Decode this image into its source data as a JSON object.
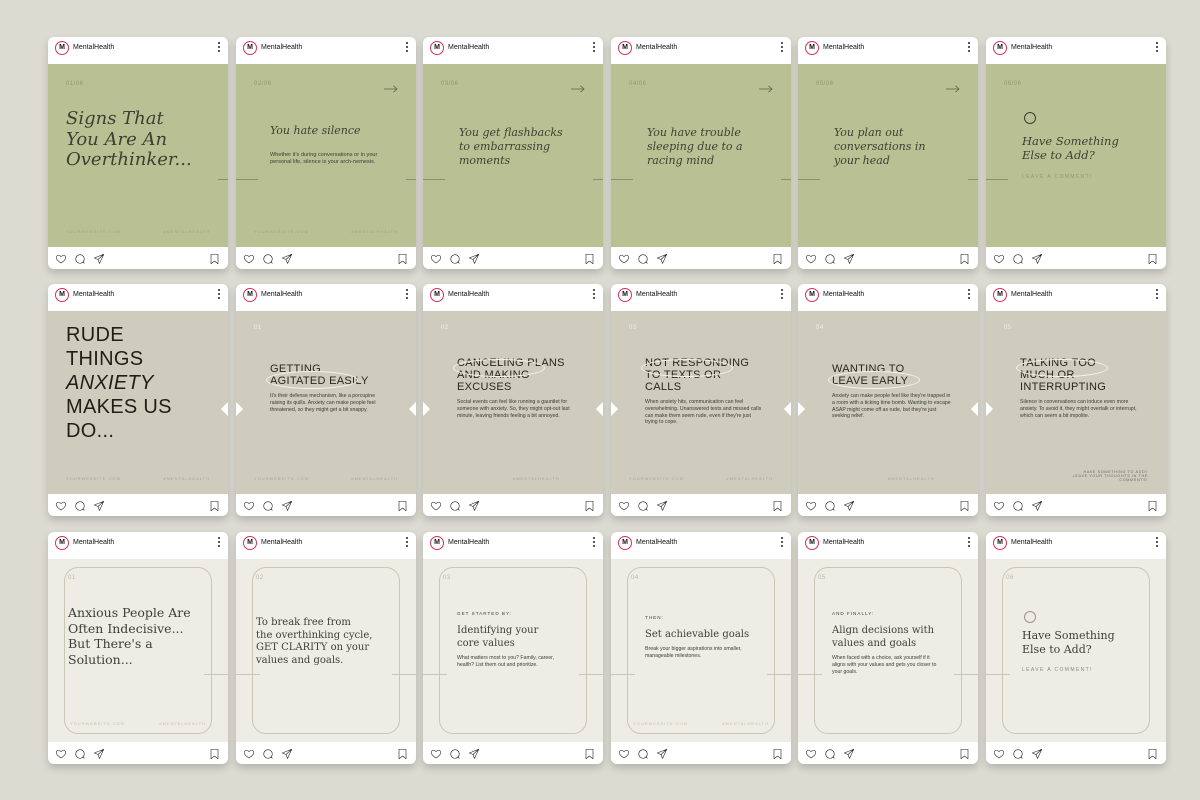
{
  "profile": {
    "username": "MentalHealth",
    "avatar_letter": "M"
  },
  "colors": {
    "green": "#b9c194",
    "beige": "#cfccbd",
    "light": "#eeede5",
    "background": "#dcdbd2"
  },
  "footer": {
    "website": "YOURWEBSITE.COM",
    "hashtag": "#MENTALHEALTH"
  },
  "row1": [
    {
      "num": "01/06",
      "title": "Signs That You Are An Overthinker...",
      "title_lines": [
        "Signs That",
        "You Are An",
        "Overthinker..."
      ]
    },
    {
      "num": "02/06",
      "title": "You hate silence",
      "body": "Whether it's during conversations or in your personal life, silence is your arch-nemesis."
    },
    {
      "num": "03/06",
      "title_lines": [
        "You get flashbacks",
        "to embarrassing",
        "moments"
      ]
    },
    {
      "num": "04/06",
      "title_lines": [
        "You have trouble",
        "sleeping due to a",
        "racing mind"
      ]
    },
    {
      "num": "05/06",
      "title_lines": [
        "You plan out",
        "conversations in",
        "your head"
      ]
    },
    {
      "num": "06/06",
      "title_lines": [
        "Have Something",
        "Else to Add?"
      ],
      "cta": "LEAVE A COMMENT!"
    }
  ],
  "row2": [
    {
      "title_lines": [
        "RUDE",
        "THINGS",
        "ANXIETY",
        "MAKES US",
        "DO..."
      ]
    },
    {
      "num": "01",
      "title_lines": [
        "GETTING",
        "AGITATED EASILY"
      ],
      "body": "It's their defense mechanism, like a porcupine raising its quills. Anxiety can make people feel threatened, so they might get a bit snappy."
    },
    {
      "num": "02",
      "title_lines": [
        "CANCELING PLANS",
        "AND MAKING",
        "EXCUSES"
      ],
      "body": "Social events can feel like running a gauntlet for someone with anxiety. So, they might opt-out last minute, leaving friends feeling a bit annoyed."
    },
    {
      "num": "03",
      "title_lines": [
        "NOT RESPONDING",
        "TO TEXTS OR",
        "CALLS"
      ],
      "body": "When anxiety hits, communication can feel overwhelming. Unanswered texts and missed calls can make them seem rude, even if they're just trying to cope."
    },
    {
      "num": "04",
      "title_lines": [
        "WANTING TO",
        "LEAVE EARLY"
      ],
      "body": "Anxiety can make people feel like they're trapped in a room with a ticking time bomb. Wanting to escape ASAP might come off as rude, but they're just seeking relief."
    },
    {
      "num": "05",
      "title_lines": [
        "TALKING TOO",
        "MUCH OR",
        "INTERRUPTING"
      ],
      "body": "Silence in conversations can induce even more anxiety. To avoid it, they might overtalk or interrupt, which can seem a bit impolite.",
      "cta": "HAVE SOMETHING TO ADD? LEAVE YOUR THOUGHTS IN THE COMMENTS!"
    }
  ],
  "row3": [
    {
      "num": "01",
      "title_lines": [
        "Anxious People Are",
        "Often Indecisive...",
        "But There's a",
        "Solution..."
      ]
    },
    {
      "num": "02",
      "title_lines": [
        "To break free from",
        "the overthinking cycle,",
        "GET CLARITY on your",
        "values and goals."
      ]
    },
    {
      "num": "03",
      "label": "GET STARTED BY:",
      "title_lines": [
        "Identifying your",
        "core values"
      ],
      "body": "What matters most to you? Family, career, health? List them out and prioritize."
    },
    {
      "num": "04",
      "label": "THEN:",
      "title_lines": [
        "Set achievable goals"
      ],
      "body": "Break your bigger aspirations into smaller, manageable milestones."
    },
    {
      "num": "05",
      "label": "AND FINALLY:",
      "title_lines": [
        "Align decisions with",
        "values and goals"
      ],
      "body": "When faced with a choice, ask yourself if it aligns with your values and gets you closer to your goals."
    },
    {
      "num": "06",
      "title_lines": [
        "Have Something",
        "Else to Add?"
      ],
      "cta": "LEAVE A COMMENT!"
    }
  ]
}
